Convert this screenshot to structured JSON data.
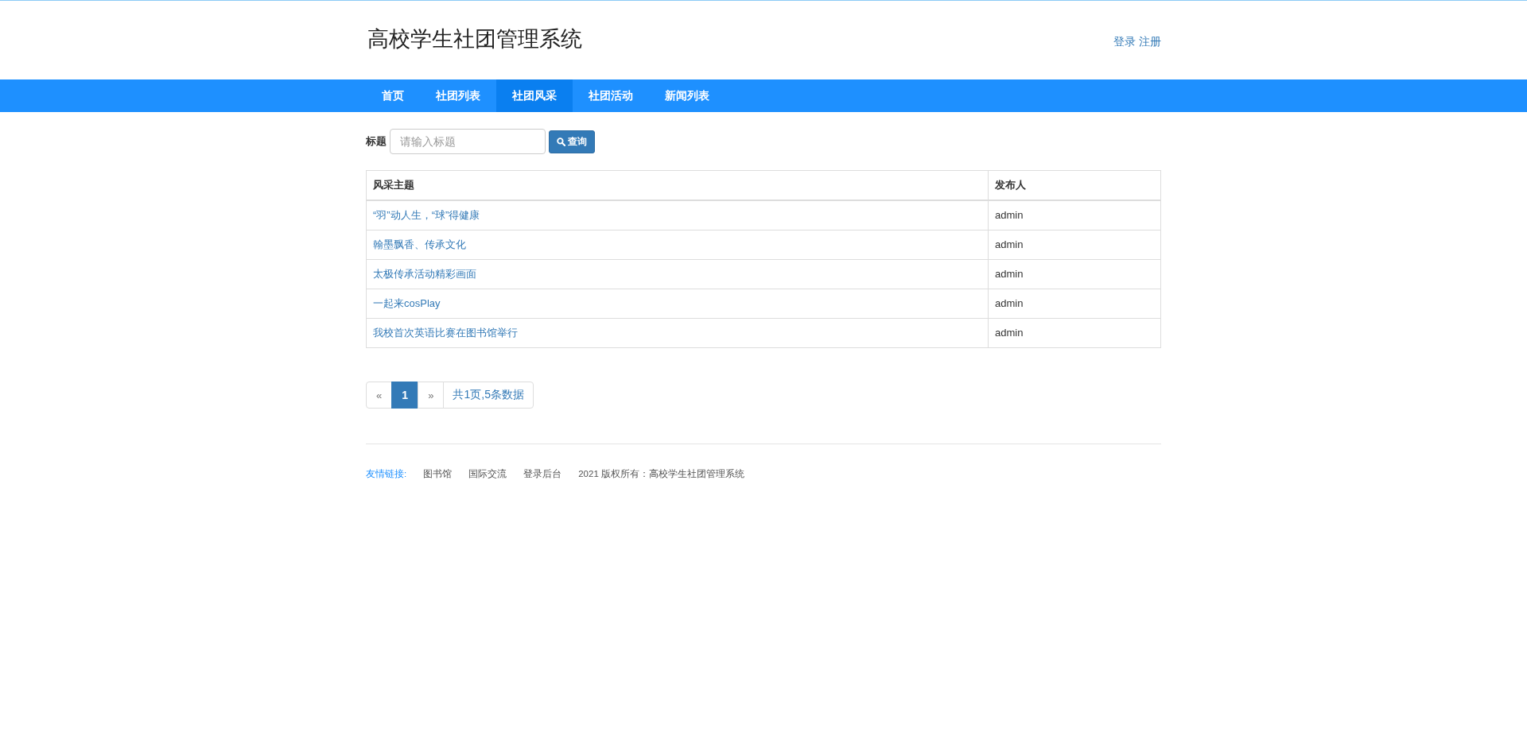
{
  "header": {
    "title": "高校学生社团管理系统",
    "links": [
      "登录",
      "注册"
    ]
  },
  "nav": [
    {
      "label": "首页",
      "selected": false
    },
    {
      "label": "社团列表",
      "selected": false
    },
    {
      "label": "社团风采",
      "selected": true
    },
    {
      "label": "社团活动",
      "selected": false
    },
    {
      "label": "新闻列表",
      "selected": false
    }
  ],
  "search": {
    "label": "标题",
    "placeholder": "请输入标题",
    "button": "查询"
  },
  "table": {
    "columns": [
      "风采主题",
      "发布人"
    ],
    "rows": [
      {
        "title": "“羽”动人生，“球”得健康",
        "author": "admin"
      },
      {
        "title": "翰墨飘香、传承文化",
        "author": "admin"
      },
      {
        "title": "太极传承活动精彩画面",
        "author": "admin"
      },
      {
        "title": "一起来cosPlay",
        "author": "admin"
      },
      {
        "title": "我校首次英语比赛在图书馆举行",
        "author": "admin"
      }
    ]
  },
  "pagination": {
    "items": [
      {
        "kind": "prev",
        "label": "«",
        "selected": false
      },
      {
        "kind": "page",
        "label": "1",
        "selected": true
      },
      {
        "kind": "next",
        "label": "»",
        "selected": false
      }
    ],
    "summary": "共1页,5条数据"
  },
  "footer": {
    "links_label": "友情链接:",
    "links": [
      "图书馆",
      "国际交流",
      "登录后台"
    ],
    "copyright": "2021 版权所有：高校学生社团管理系统"
  }
}
